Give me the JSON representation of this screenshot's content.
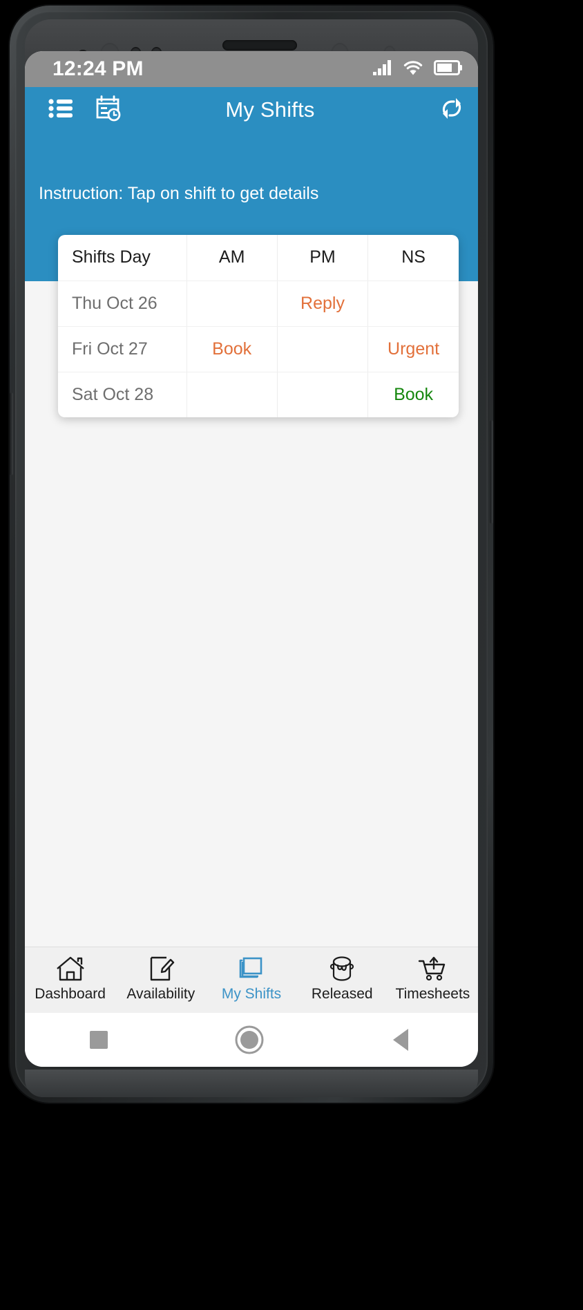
{
  "status_bar": {
    "clock": "12:24 PM",
    "icons": [
      "signal-icon",
      "wifi-icon",
      "battery-icon"
    ]
  },
  "app_bar": {
    "title": "My Shifts",
    "left_icons": [
      "list-icon",
      "calendar-clock-icon"
    ],
    "right_icon": "refresh-icon",
    "background_color": "#2b8ec1"
  },
  "hero": {
    "instruction": "Instruction: Tap on shift to get details"
  },
  "shift_table": {
    "headers": [
      "Shifts Day",
      "AM",
      "PM",
      "NS"
    ],
    "rows": [
      {
        "day": "Thu Oct 26",
        "am": "",
        "pm": "Reply",
        "ns": ""
      },
      {
        "day": "Fri Oct 27",
        "am": "Book",
        "pm": "",
        "ns": "Urgent"
      },
      {
        "day": "Sat Oct 28",
        "am": "",
        "pm": "",
        "ns": "Book"
      }
    ],
    "status_colors": {
      "reply": "#e2703a",
      "book_orange": "#e2703a",
      "urgent": "#e2703a",
      "book_green": "#16870f"
    }
  },
  "tab_bar": {
    "items": [
      {
        "label": "Dashboard",
        "icon": "home-icon",
        "active": false
      },
      {
        "label": "Availability",
        "icon": "edit-note-icon",
        "active": false
      },
      {
        "label": "My Shifts",
        "icon": "layers-copy-icon",
        "active": true
      },
      {
        "label": "Released",
        "icon": "paint-bucket-icon",
        "active": false
      },
      {
        "label": "Timesheets",
        "icon": "cart-upload-icon",
        "active": false
      }
    ],
    "active_color": "#3c93c7"
  },
  "nav_bar": {
    "keys": [
      "recents-square-key",
      "home-circle-key",
      "back-triangle-key"
    ]
  }
}
